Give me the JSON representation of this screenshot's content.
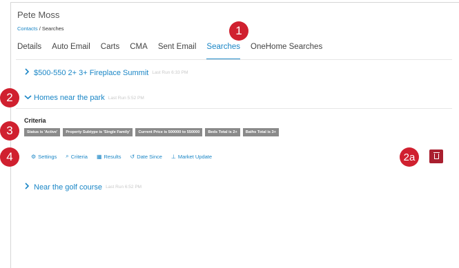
{
  "contact": {
    "name": "Pete Moss"
  },
  "breadcrumb": {
    "link": "Contacts",
    "separator": " / ",
    "current": "Searches"
  },
  "tabs": [
    {
      "label": "Details",
      "active": false
    },
    {
      "label": "Auto Email",
      "active": false
    },
    {
      "label": "Carts",
      "active": false
    },
    {
      "label": "CMA",
      "active": false
    },
    {
      "label": "Sent Email",
      "active": false
    },
    {
      "label": "Searches",
      "active": true
    },
    {
      "label": "OneHome Searches",
      "active": false
    }
  ],
  "searches": [
    {
      "name": "$500-550 2+ 3+ Fireplace Summit",
      "last_run": "Last Run 6:33 PM",
      "expanded": false
    },
    {
      "name": "Homes near the park",
      "last_run": "Last Run 5:52 PM",
      "expanded": true
    },
    {
      "name": "Near the golf course",
      "last_run": "Last Run 6:52 PM",
      "expanded": false
    }
  ],
  "criteria": {
    "title": "Criteria",
    "chips": [
      "Status is 'Active'",
      "Property Subtype is 'Single Family'",
      "Current Price is 500000 to 550000",
      "Beds Total is 2+",
      "Baths Total is 3+"
    ]
  },
  "actions": [
    {
      "label": "Settings",
      "icon": "gear-icon",
      "glyph": "⚙"
    },
    {
      "label": "Criteria",
      "icon": "search-icon",
      "glyph": "⌕"
    },
    {
      "label": "Results",
      "icon": "table-icon",
      "glyph": "▦"
    },
    {
      "label": "Date Since",
      "icon": "history-icon",
      "glyph": "↺"
    },
    {
      "label": "Market Update",
      "icon": "chart-icon",
      "glyph": "⊥"
    }
  ],
  "annotations": [
    "1",
    "2",
    "3",
    "4",
    "2a"
  ],
  "colors": {
    "accent": "#1a86c6",
    "badge": "#d0202f",
    "delete": "#a91f2f",
    "chip": "#8a8a8a"
  }
}
